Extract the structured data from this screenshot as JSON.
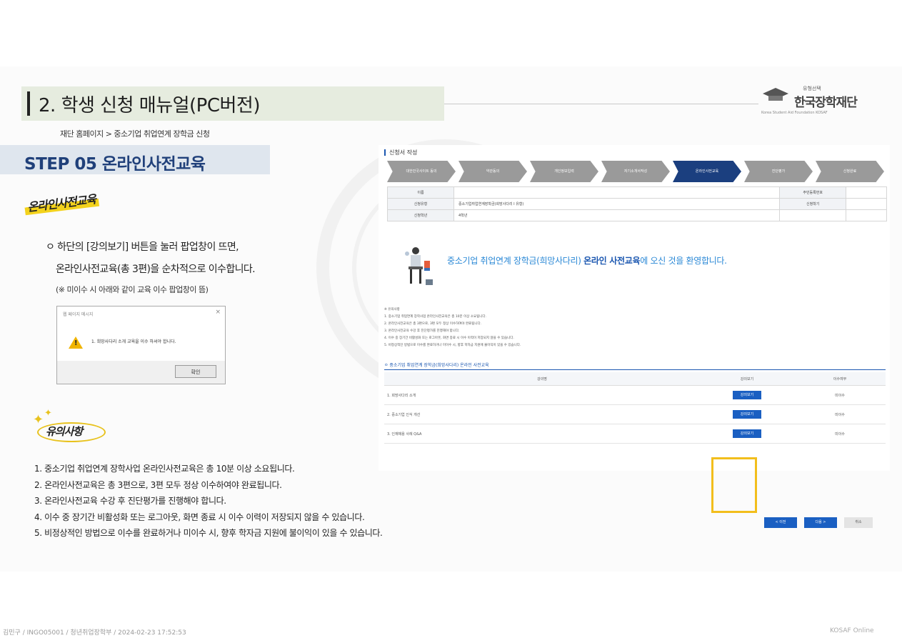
{
  "header": {
    "title": "2. 학생 신청 매뉴얼(PC버전)",
    "breadcrumb": "재단 홈페이지 > 중소기업 취업연계 장학금 신청",
    "step_title": "STEP 05 온라인사전교육",
    "logo_small": "유형선택",
    "logo_name": "한국장학재단",
    "logo_sub": "Korea Student Aid Foundation KOSAF"
  },
  "left": {
    "badge_online": "온라인사전교육",
    "bullet_line1": "ㅇ 하단의 [강의보기] 버튼을 눌러 팝업창이 뜨면,",
    "bullet_line2": "온라인사전교육(총 3편)을 순차적으로 이수합니다.",
    "note": "(※ 미이수 시 아래와 같이 교육 이수 팝업창이 뜸)",
    "badge_caution": "유의사항",
    "precautions": [
      "1. 중소기업 취업연계 장학사업 온라인사전교육은 총 10분 이상 소요됩니다.",
      "2. 온라인사전교육은 총 3편으로, 3편 모두 정상 이수하여야 완료됩니다.",
      "3. 온라인사전교육 수강 후 진단평가를 진행해야 합니다.",
      "4. 이수 중 장기간 비활성화 또는 로그아웃, 화면 종료 시 이수 이력이 저장되지 않을 수 있습니다.",
      "5. 비정상적인 방법으로 이수를 완료하거나 미이수 시, 향후 학자금 지원에 불이익이 있을 수 있습니다."
    ]
  },
  "dialog": {
    "title": "웹 페이지 메시지",
    "close": "×",
    "message": "1. 희망사다리 소개 교육을 이수 하셔야 합니다.",
    "ok_label": "확인"
  },
  "form": {
    "title": "신청서 작성",
    "steps": [
      "대한민국사이트 동의",
      "약관동의",
      "개인정보입력",
      "자기소개서작성",
      "온라인사전교육",
      "진단평가",
      "신청완료"
    ],
    "info_rows": [
      [
        "이름",
        "",
        "주민등록번호",
        ""
      ],
      [
        "신청유형",
        "중소기업취업연계장학금(희망사다리 I 유형)",
        "신청학기",
        ""
      ],
      [
        "신청학년",
        "4학년",
        "",
        ""
      ]
    ],
    "welcome_text": "중소기업 취업연계 장학금(희망사다리) ",
    "welcome_bold": "온라인 사전교육",
    "welcome_tail": "에 오신 것을 환영합니다.",
    "notes": [
      "※ 유의사항",
      "1. 중소기업 취업연계 장학사업 온라인사전교육은 총 10분 이상 소요됩니다.",
      "2. 온라인사전교육은 총 3편으로, 3편 모두 정상 이수하여야 완료됩니다.",
      "3. 온라인사전교육 수강 후 진단평가를 진행해야 합니다.",
      "4. 이수 중 장기간 비활성화 또는 로그아웃, 화면 종료 시 이수 이력이 저장되지 않을 수 있습니다.",
      "5. 비정상적인 방법으로 이수를 완료하거나 미이수 시, 향후 학자금 지원에 불이익이 있을 수 있습니다."
    ],
    "section_title": "ㅇ 중소기업 취업연계 장학금(희망사다리) 온라인 사전교육",
    "course_headers": [
      "강의명",
      "강의보기",
      "이수여부"
    ],
    "courses": [
      {
        "name": "1. 희망사다리 소개",
        "button": "강의보기",
        "status": "미이수"
      },
      {
        "name": "2. 중소기업 인식 개선",
        "button": "강의보기",
        "status": "미이수"
      },
      {
        "name": "3. 인재채용 사례 Q&A",
        "button": "강의보기",
        "status": "미이수"
      }
    ],
    "prev_label": "< 이전",
    "next_label": "다음 >",
    "cancel_label": "취소"
  },
  "footer": {
    "left": "김민구 / INGO05001 / 청년취업장학부 / 2024-02-23 17:52:53",
    "right": "KOSAF Online"
  },
  "colors": {
    "accent": "#1b3f7f",
    "button_blue": "#1a5fc2",
    "highlight": "#f2be1c",
    "welcome_blue": "#2a88d6"
  }
}
